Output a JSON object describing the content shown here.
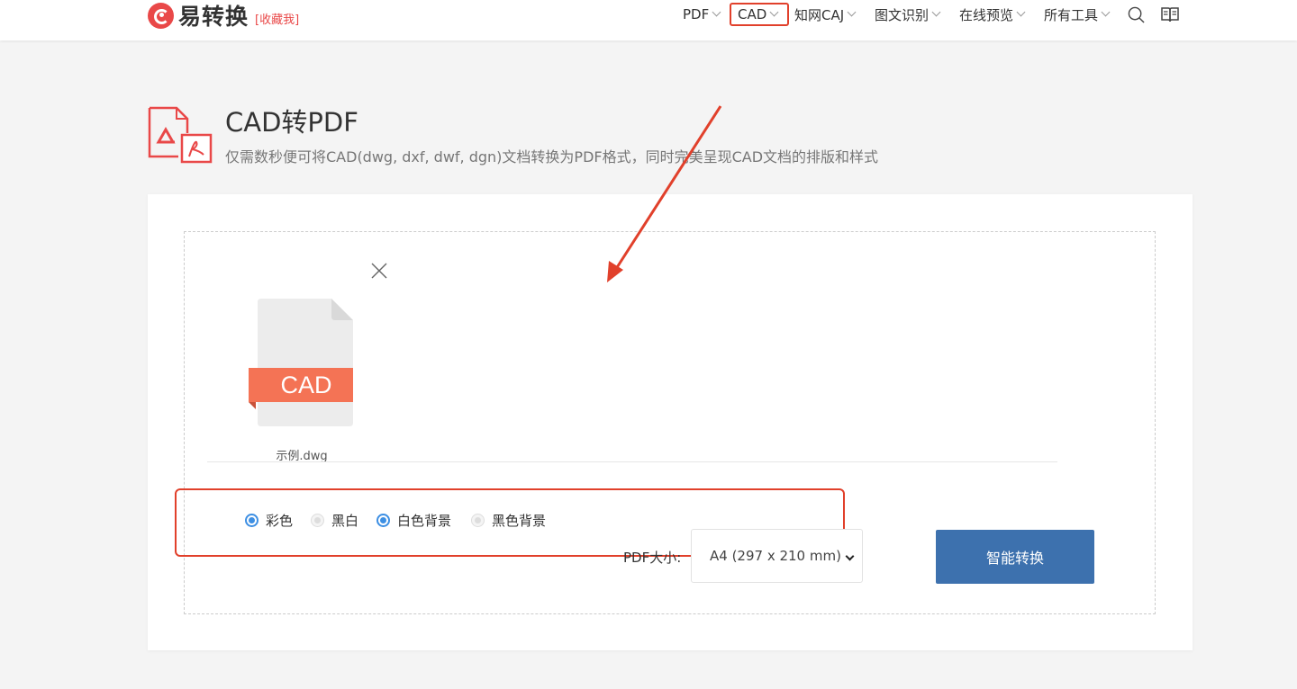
{
  "header": {
    "logo_text": "易转换",
    "favorite_label": "[收藏我]",
    "nav": [
      {
        "label": "PDF"
      },
      {
        "label": "CAD"
      },
      {
        "label": "知网CAJ"
      },
      {
        "label": "图文识别"
      },
      {
        "label": "在线预览"
      },
      {
        "label": "所有工具"
      }
    ],
    "icons": [
      "search-icon",
      "book-icon"
    ]
  },
  "page": {
    "title": "CAD转PDF",
    "description": "仅需数秒便可将CAD(dwg, dxf, dwf, dgn)文档转换为PDF格式，同时完美呈现CAD文档的排版和样式"
  },
  "upload": {
    "file_badge": "CAD",
    "file_name": "示例.dwg"
  },
  "options": {
    "color_modes": [
      {
        "label": "彩色",
        "selected": true
      },
      {
        "label": "黑白",
        "selected": false
      }
    ],
    "backgrounds": [
      {
        "label": "白色背景",
        "selected": true
      },
      {
        "label": "黑色背景",
        "selected": false
      }
    ],
    "pdf_size_label": "PDF大小:",
    "pdf_size_value": "A4 (297 x 210 mm)"
  },
  "actions": {
    "convert_label": "智能转换"
  },
  "colors": {
    "brand_red": "#e94848",
    "highlight_red": "#e1402b",
    "primary_blue": "#3d71ae",
    "radio_blue": "#3d8fe3",
    "cad_orange": "#f47355"
  }
}
